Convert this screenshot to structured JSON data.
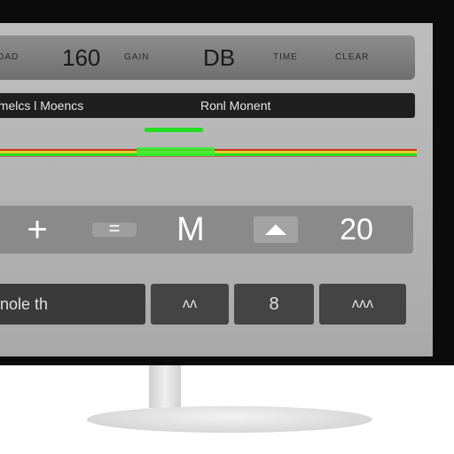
{
  "display": {
    "top_row": {
      "small_1": "LOAD",
      "big_1": "160",
      "small_2": "GAIN",
      "big_2": "DB",
      "small_3": "TIME",
      "small_4": "CLEAR"
    },
    "mode_row": {
      "left_label": "amelcs l Moencs",
      "right_label": "Ronl Monent"
    },
    "key_row": {
      "plus_label": "+",
      "minus_label": "=",
      "m_label": "M",
      "up_icon": "caret-up-icon",
      "value": "20"
    },
    "bottom_row": {
      "field_label": "nole th",
      "button_1_label": "ᴧᴧ",
      "button_2_label": "8",
      "button_3_label": "ᴧᴧᴧ"
    }
  },
  "colors": {
    "bezel": "#0b0b0b",
    "screen": "#b5b5b5",
    "panel_dark": "#1f1f1f",
    "button": "#444444",
    "meter_green": "#22dd22",
    "meter_yellow": "#ddcc22",
    "meter_red": "#ee3322"
  }
}
